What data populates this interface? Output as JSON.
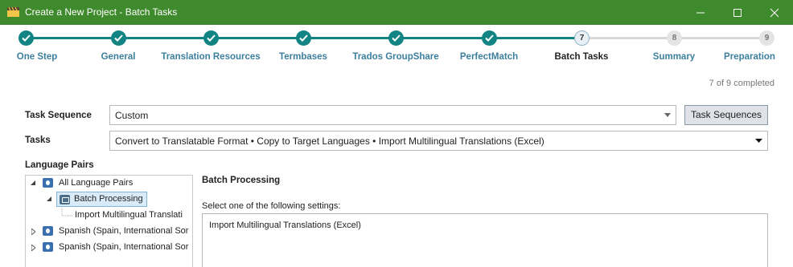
{
  "window": {
    "title": "Create a New Project - Batch Tasks",
    "controls": {
      "minimize": "minimize-icon",
      "maximize": "maximize-icon",
      "close": "close-icon"
    }
  },
  "steps": [
    {
      "number": "1",
      "label": "One Step",
      "state": "done"
    },
    {
      "number": "2",
      "label": "General",
      "state": "done"
    },
    {
      "number": "3",
      "label": "Translation Resources",
      "state": "done"
    },
    {
      "number": "4",
      "label": "Termbases",
      "state": "done"
    },
    {
      "number": "5",
      "label": "Trados GroupShare",
      "state": "done"
    },
    {
      "number": "6",
      "label": "PerfectMatch",
      "state": "done"
    },
    {
      "number": "7",
      "label": "Batch Tasks",
      "state": "current"
    },
    {
      "number": "8",
      "label": "Summary",
      "state": "todo"
    },
    {
      "number": "9",
      "label": "Preparation",
      "state": "todo"
    }
  ],
  "progress": {
    "text": "7 of 9 completed"
  },
  "task_sequence": {
    "label": "Task Sequence",
    "value": "Custom",
    "button": "Task Sequences"
  },
  "tasks": {
    "label": "Tasks",
    "value": "Convert to Translatable Format • Copy to Target Languages • Import Multilingual Translations (Excel)"
  },
  "language_pairs": {
    "label": "Language Pairs",
    "tree": {
      "all": "All Language Pairs",
      "batch": "Batch Processing",
      "import": "Import Multilingual Translati",
      "pair1": "Spanish (Spain, International Sor",
      "pair2": "Spanish (Spain, International Sor"
    }
  },
  "batch_processing": {
    "title": "Batch Processing",
    "select_label": "Select one of the following settings:",
    "settings": [
      "Import Multilingual Translations (Excel)"
    ]
  },
  "colors": {
    "titlebar": "#3f8a2d",
    "step_done": "#138484",
    "step_label": "#3d7f9e"
  }
}
